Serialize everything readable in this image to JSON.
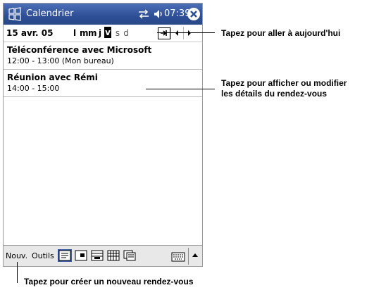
{
  "titlebar": {
    "app_title": "Calendrier",
    "clock": "07:39",
    "icons": [
      "start-icon",
      "sync-icon",
      "volume-icon",
      "close-icon"
    ]
  },
  "datebar": {
    "date": "15 avr. 05",
    "days": [
      "l",
      "m",
      "m",
      "j",
      "v",
      "s",
      "d"
    ],
    "selected_day_index": 4
  },
  "appointments": [
    {
      "title": "Téléconférence avec Microsoft",
      "time": "12:00 - 13:00 (Mon bureau)"
    },
    {
      "title": "Réunion avec Rémi",
      "time": "14:00 - 15:00"
    }
  ],
  "toolbar": {
    "new_label": "Nouv.",
    "tools_label": "Outils",
    "views": [
      "agenda-view-icon",
      "day-view-icon",
      "week-view-icon",
      "month-view-icon",
      "year-view-icon"
    ],
    "active_view_index": 0
  },
  "callouts": {
    "today": "Tapez pour aller à aujourd'hui",
    "details_line1": "Tapez pour afficher ou modifier",
    "details_line2": "les détails du rendez-vous",
    "new_appt": "Tapez pour créer un nouveau rendez-vous"
  },
  "colors": {
    "titlebar": "#2e4f96",
    "selected": "#000000",
    "toolbar": "#e8e8e8"
  }
}
